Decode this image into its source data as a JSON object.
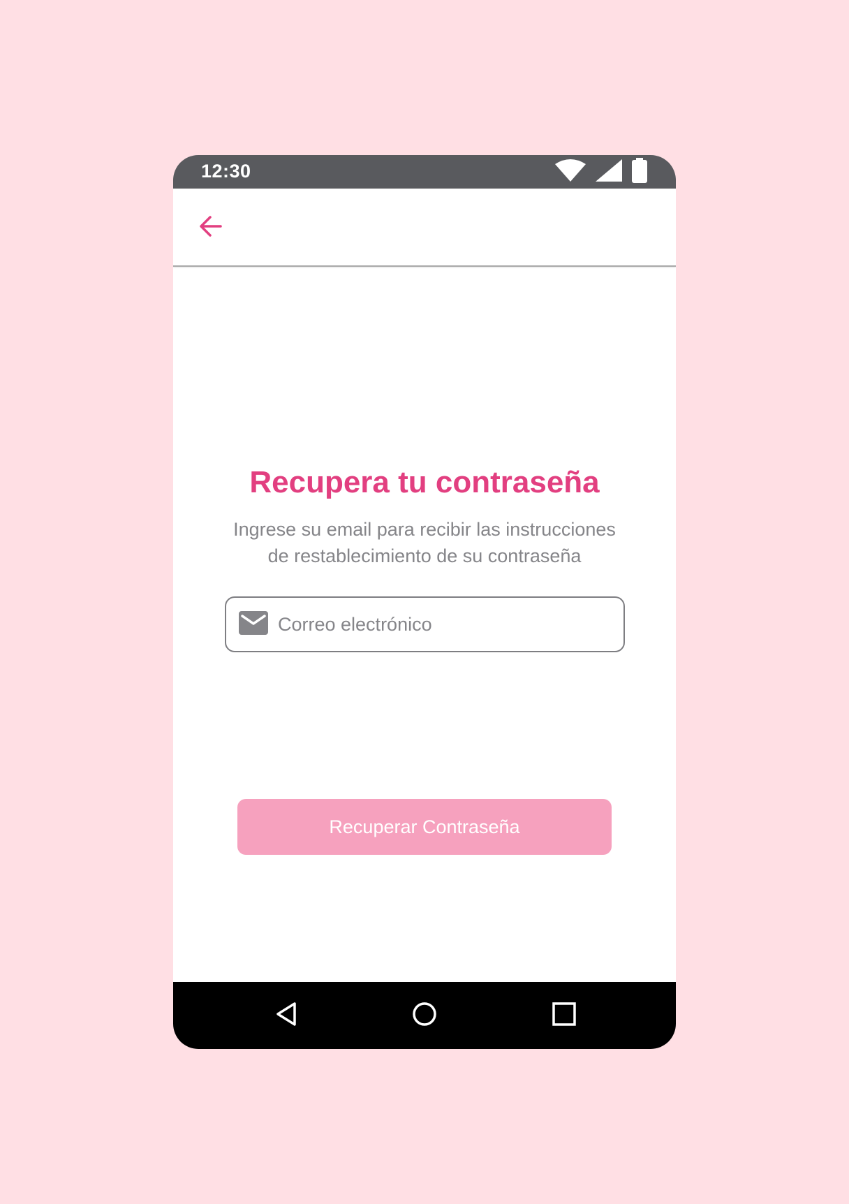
{
  "status_bar": {
    "time": "12:30",
    "icons": [
      "wifi-icon",
      "cell-signal-icon",
      "battery-icon"
    ]
  },
  "app_bar": {
    "back_icon": "arrow-left-icon"
  },
  "main": {
    "title": "Recupera tu contraseña",
    "subtitle_line1": "Ingrese su email para recibir las instrucciones",
    "subtitle_line2": "de restablecimiento de su contraseña",
    "email_field": {
      "icon": "mail-icon",
      "placeholder": "Correo electrónico",
      "value": ""
    },
    "recover_button_label": "Recuperar Contraseña"
  },
  "nav_bar": {
    "icons": [
      "back-triangle-icon",
      "home-circle-icon",
      "recents-square-icon"
    ]
  },
  "colors": {
    "page_background": "#FFDFE4",
    "accent": "#E23F80",
    "button_disabled": "#F6A1BE",
    "status_bar": "#595A5E",
    "nav_bar": "#000000",
    "muted_text": "#858589"
  }
}
